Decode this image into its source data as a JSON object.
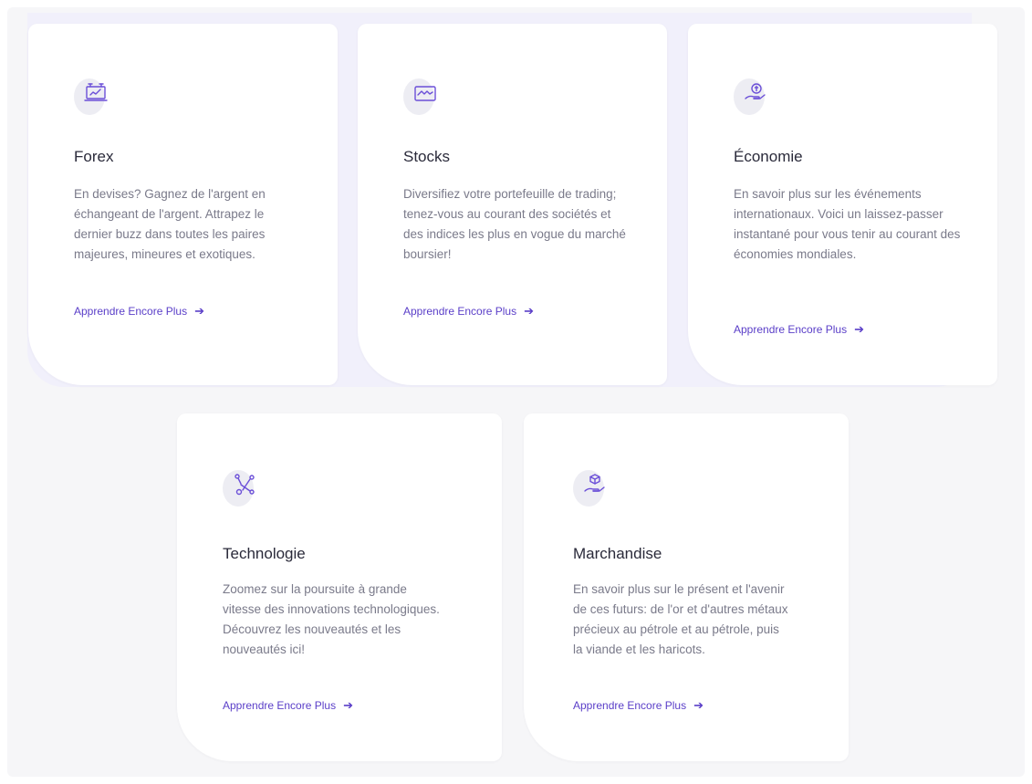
{
  "colors": {
    "accent": "#5a3ec8",
    "icon_stroke": "#6b4fd8",
    "title": "#2a2a3a",
    "text": "#7a7a8a",
    "background": "#f6f6f8"
  },
  "cards": [
    {
      "icon": "trading-monitor-icon",
      "title": "Forex",
      "description": "En devises? Gagnez de l'argent en échangeant de l'argent. Attrapez le dernier buzz dans toutes les paires majeures, mineures et exotiques.",
      "link_label": "Apprendre Encore Plus"
    },
    {
      "icon": "stock-chart-icon",
      "title": "Stocks",
      "description": "Diversifiez votre portefeuille de trading; tenez-vous au courant des sociétés et des indices les plus en vogue du marché boursier!",
      "link_label": "Apprendre Encore Plus"
    },
    {
      "icon": "coin-hand-icon",
      "title": "Économie",
      "description": "En savoir plus sur les événements internationaux. Voici un laissez-passer instantané pour vous tenir au courant des économies mondiales.",
      "link_label": "Apprendre Encore Plus"
    },
    {
      "icon": "network-nodes-icon",
      "title": "Technologie",
      "description": "Zoomez sur la poursuite à grande vitesse des innovations technologiques. Découvrez les nouveautés et les nouveautés ici!",
      "link_label": "Apprendre Encore Plus"
    },
    {
      "icon": "box-hand-icon",
      "title": "Marchandise",
      "description": "En savoir plus sur le présent et l'avenir de ces futurs: de l'or et d'autres métaux précieux au pétrole et au pétrole, puis la viande et les haricots.",
      "link_label": "Apprendre Encore Plus"
    }
  ]
}
